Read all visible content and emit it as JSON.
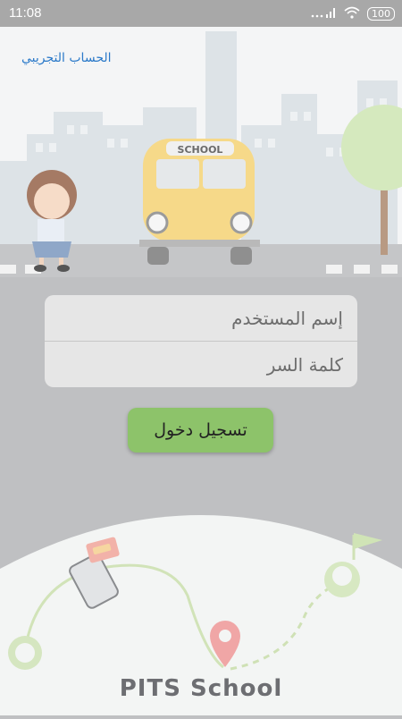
{
  "status_bar": {
    "time": "11:08",
    "battery": "100"
  },
  "header": {
    "demo_account_link": "الحساب التجريبي"
  },
  "illustration": {
    "bus_sign": "SCHOOL"
  },
  "login_form": {
    "username_placeholder": "إسم المستخدم",
    "password_placeholder": "كلمة السر",
    "login_button": "تسجيل دخول"
  },
  "footer": {
    "app_name": "PITS School"
  },
  "colors": {
    "accent_green": "#8dc36a",
    "link_blue": "#2a79c9",
    "background_gray": "#bfc0c2"
  }
}
